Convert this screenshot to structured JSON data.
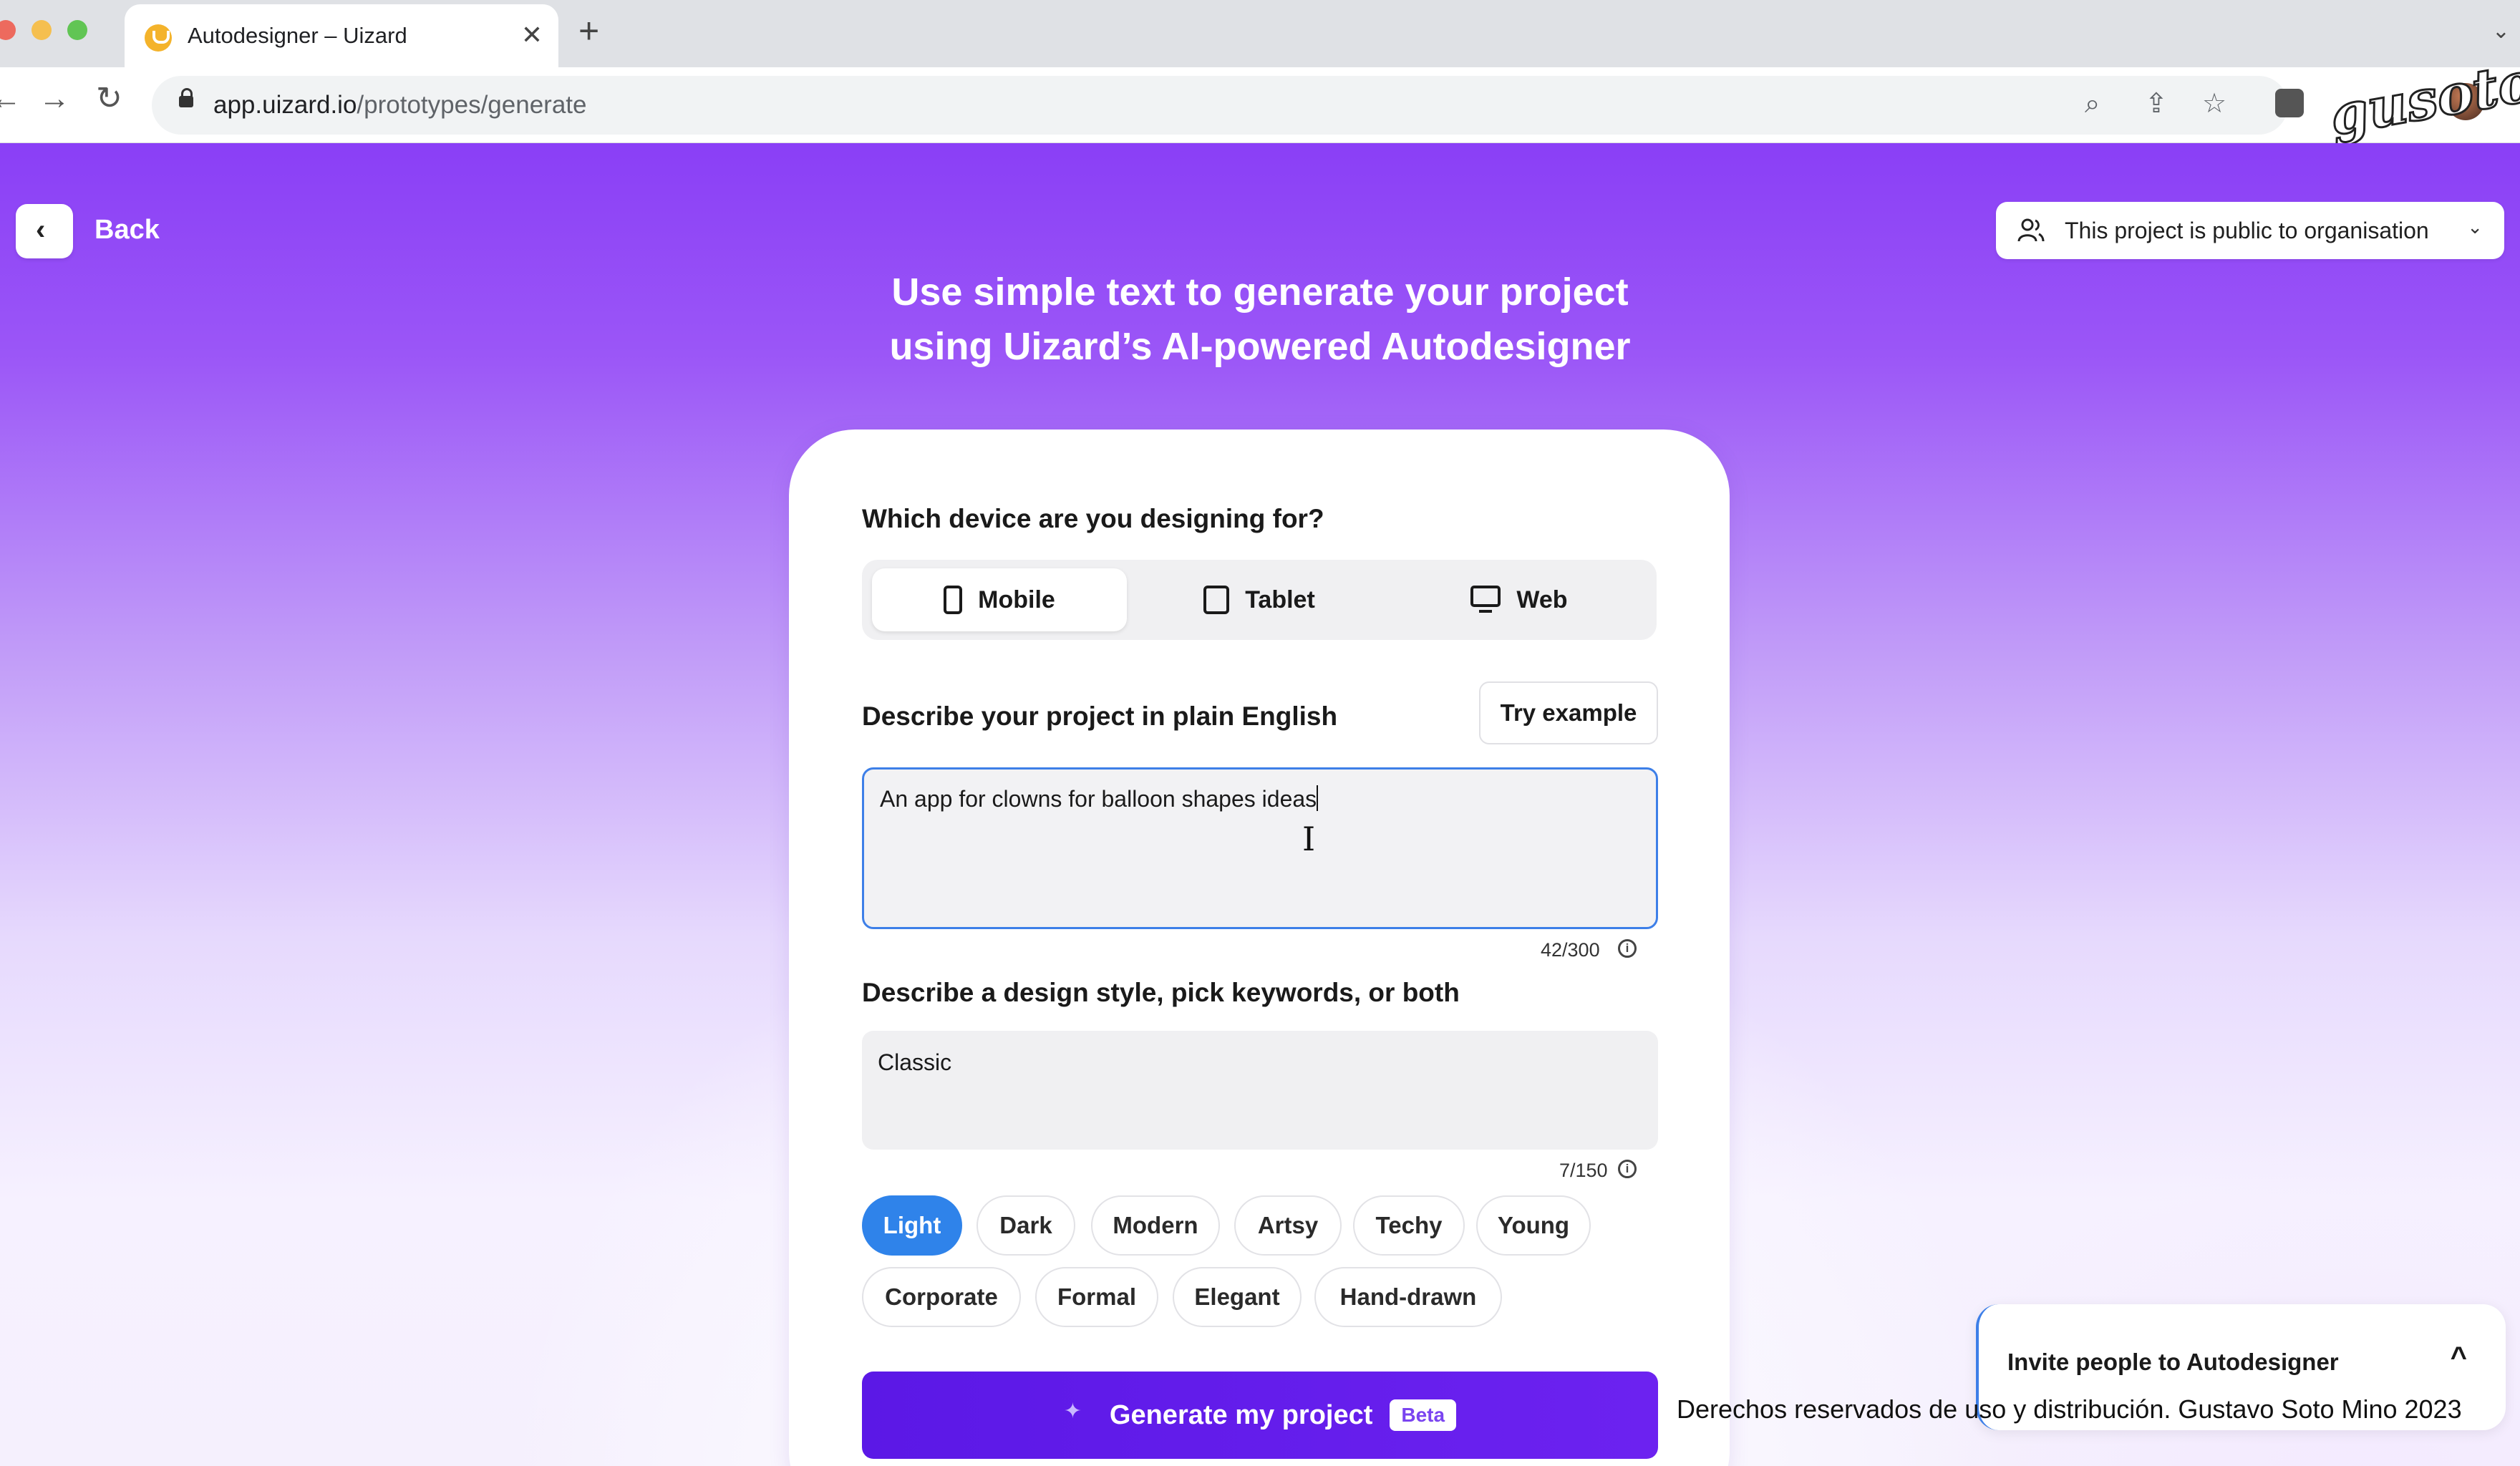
{
  "browser": {
    "tab_title": "Autodesigner – Uizard",
    "tab_close": "✕",
    "new_tab": "+",
    "tab_menu": "⌄",
    "url_domain": "app.uizard.io",
    "url_path": "/prototypes/generate",
    "back_glyph": "←",
    "forward_glyph": "→",
    "reload_glyph": "↻",
    "search_glyph": "⌕",
    "share_glyph": "⇪",
    "bookmark_glyph": "☆",
    "watermark_text": "gusoto"
  },
  "page": {
    "back_label": "Back",
    "visibility_label": "This project is public to organisation",
    "headline_line1": "Use simple text to generate your project",
    "headline_line2": "using Uizard’s AI-powered Autodesigner"
  },
  "form": {
    "device_question": "Which device are you designing for?",
    "devices": [
      "Mobile",
      "Tablet",
      "Web"
    ],
    "selected_device": "Mobile",
    "describe_label": "Describe your project in plain English",
    "try_example_label": "Try example",
    "project_description": "An app for clowns for balloon shapes ideas",
    "project_counter": "42/300",
    "style_label": "Describe a design style, pick keywords, or both",
    "style_value": "Classic",
    "style_counter": "7/150",
    "keywords": [
      "Light",
      "Dark",
      "Modern",
      "Artsy",
      "Techy",
      "Young",
      "Corporate",
      "Formal",
      "Elegant",
      "Hand-drawn"
    ],
    "selected_keyword": "Light",
    "generate_label": "Generate my project",
    "beta_label": "Beta"
  },
  "invite": {
    "label": "Invite people to Autodesigner"
  },
  "footer": {
    "copyright": "Derechos reservados de uso y distribución. Gustavo Soto Mino 2023"
  },
  "colors": {
    "brand_purple": "#6c22f0",
    "selected_chip": "#2f83ea",
    "focus_border": "#3d7fe8"
  }
}
